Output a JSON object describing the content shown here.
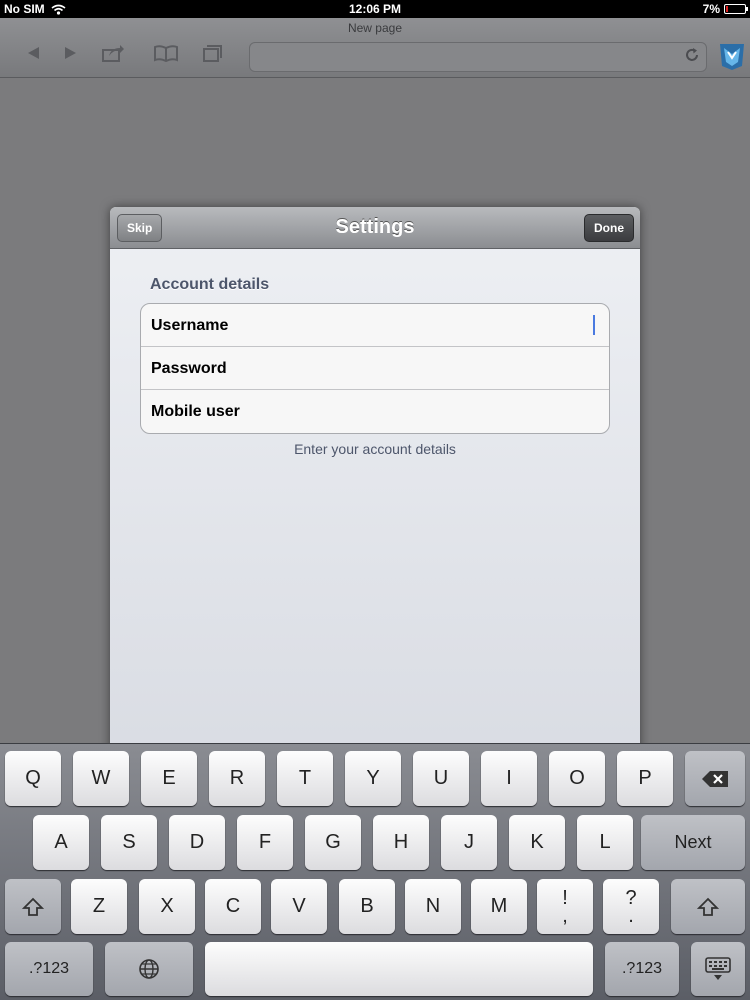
{
  "status_bar": {
    "carrier": "No SIM",
    "time": "12:06 PM",
    "battery": "7%"
  },
  "browser": {
    "page_title": "New page",
    "icons": [
      "back-arrow-icon",
      "forward-arrow-icon",
      "share-icon",
      "bookmarks-book-icon",
      "tabs-icon",
      "reload-icon"
    ]
  },
  "dialog": {
    "title": "Settings",
    "skip_label": "Skip",
    "done_label": "Done",
    "section_label": "Account details",
    "fields": [
      {
        "label": "Username"
      },
      {
        "label": "Password"
      },
      {
        "label": "Mobile user"
      }
    ],
    "hint": "Enter your account details"
  },
  "keyboard": {
    "row1": [
      "Q",
      "W",
      "E",
      "R",
      "T",
      "Y",
      "U",
      "I",
      "O",
      "P"
    ],
    "row2": [
      "A",
      "S",
      "D",
      "F",
      "G",
      "H",
      "J",
      "K",
      "L"
    ],
    "row3": [
      "Z",
      "X",
      "C",
      "V",
      "B",
      "N",
      "M"
    ],
    "next_label": "Next",
    "punct1_top": "!",
    "punct1_bottom": ",",
    "punct2_top": "?",
    "punct2_bottom": ".",
    "numbers_label": ".?123"
  },
  "colors": {
    "accent_caret": "#4a7ae0",
    "battery_low": "#d22222"
  }
}
